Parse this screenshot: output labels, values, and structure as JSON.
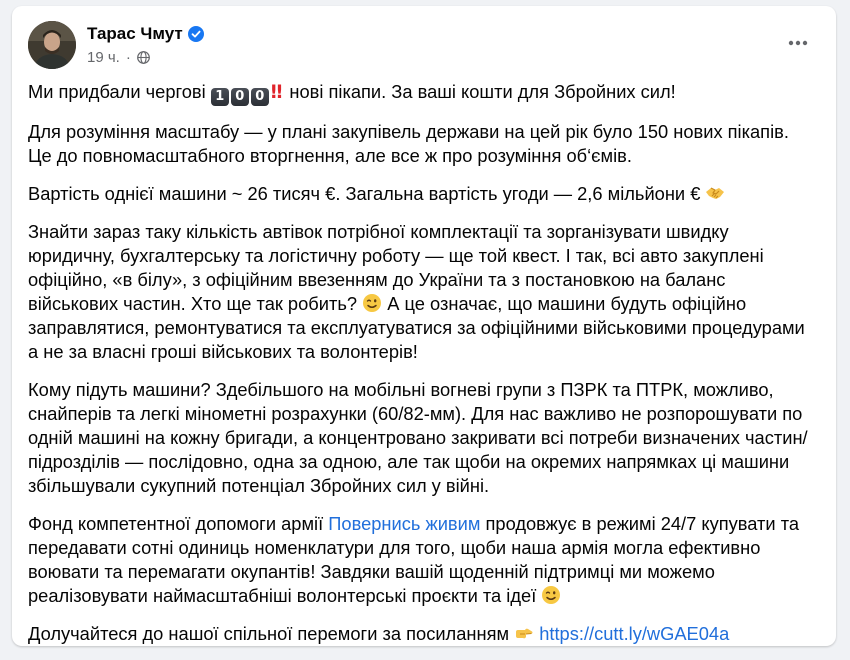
{
  "post": {
    "author_name": "Тарас Чмут",
    "timestamp": "19 ч.",
    "separator": "·",
    "verified_icon": "verified-badge-icon",
    "privacy_icon": "globe-icon",
    "more_icon": "more-options-icon"
  },
  "content": {
    "p1_a": "Ми придбали чергові",
    "p1_keycaps": [
      "1",
      "0",
      "0"
    ],
    "p1_emphasis": "‼",
    "p1_b": "нові пікапи. За ваші кошти для Збройних сил!",
    "p2": "Для розуміння масштабу — у плані закупівель держави на цей рік було 150 нових пікапів. Це до повномасштабного вторгнення, але все ж про розуміння об‘ємів.",
    "p3": "Вартість однієї машини ~ 26 тисяч €. Загальна вартість угоди — 2,6 мільйони €",
    "p4_a": "Знайти зараз таку кількість автівок потрібної комплектації та зорганізувати швидку юридичну, бухгалтерську та логістичну роботу — ще той квест. І так, всі авто закуплені офіційно, «в білу», з офіційним ввезенням до України та з постановкою на баланс військових частин. Хто ще так робить?",
    "p4_b": "А це означає, що машини будуть офіційно заправлятися, ремонтуватися та експлуатуватися за офіційними військовими процедурами а не за власні гроші військових та волонтерів!",
    "p5": "Кому підуть машини? Здебільшого на мобільні вогневі групи з ПЗРК та ПТРК, можливо, снайперів та легкі мінометні розрахунки (60/82-мм). Для нас важливо не розпорошувати по одній машині на кожну бригади, а концентровано закривати всі потреби визначених частин/підрозділів — послідовно, одна за одною, але так щоби на окремих напрямках ці машини збільшували сукупний потенціал Збройних сил у війні.",
    "p6_a": "Фонд компетентної допомоги армії",
    "p6_link": "Повернись живим",
    "p6_b": "продовжує в режимі 24/7 купувати та передавати сотні одиниць номенклатури для того, щоби наша армія могла ефективно воювати та перемагати окупантів! Завдяки вашій щоденній підтримці ми можемо реалізовувати наймасштабніші волонтерські проєкти та ідеї",
    "p7_a": "Долучайтеся до нашої спільної перемоги за посиланням",
    "p7_link": "https://cutt.ly/wGAE04a",
    "emoji_handshake": "handshake-emoji",
    "emoji_wink": "wink-emoji",
    "emoji_point_right": "point-right-emoji"
  },
  "colors": {
    "link": "#216fdb",
    "verified": "#1877f2",
    "meta": "#65676b",
    "text": "#050505"
  }
}
